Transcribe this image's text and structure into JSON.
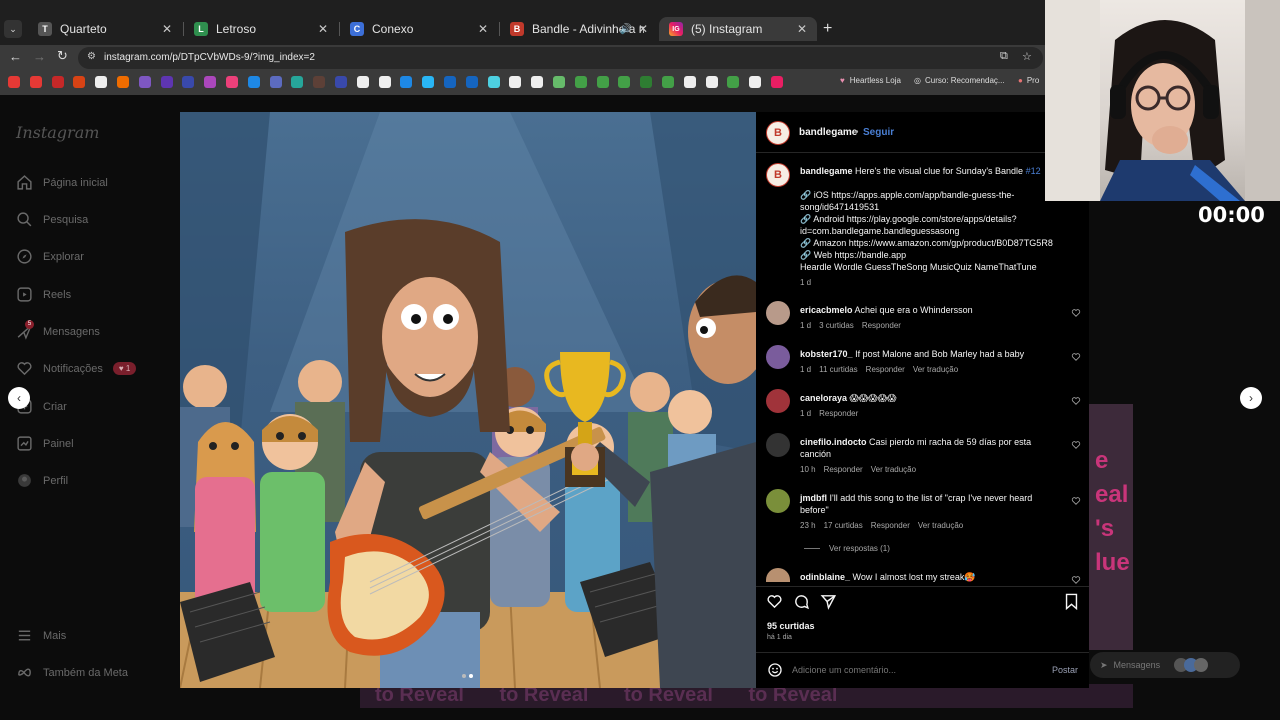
{
  "tabs": [
    {
      "label": "Quarteto",
      "favicon": "T"
    },
    {
      "label": "Letroso",
      "favicon": "L"
    },
    {
      "label": "Conexo",
      "favicon": "C"
    },
    {
      "label": "Bandle - Adivinhe a música",
      "favicon": "B"
    },
    {
      "label": "(5) Instagram",
      "favicon": "IG"
    }
  ],
  "new_tab": "+",
  "url": "instagram.com/p/DTpCVbWDs-9/?img_index=2",
  "bookmarks": [
    {
      "label": "Heartless Loja"
    },
    {
      "label": "Curso: Recomendaç..."
    },
    {
      "label": "Pro"
    }
  ],
  "sidebar": {
    "logo": "Instagram",
    "items": [
      {
        "label": "Página inicial",
        "icon": "home-icon"
      },
      {
        "label": "Pesquisa",
        "icon": "search-icon"
      },
      {
        "label": "Explorar",
        "icon": "compass-icon"
      },
      {
        "label": "Reels",
        "icon": "reels-icon"
      },
      {
        "label": "Mensagens",
        "icon": "messenger-icon",
        "badge": "5"
      },
      {
        "label": "Notificações",
        "icon": "heart-icon",
        "badge": "1"
      },
      {
        "label": "Criar",
        "icon": "plus-icon"
      },
      {
        "label": "Painel",
        "icon": "dashboard-icon"
      },
      {
        "label": "Perfil",
        "icon": "avatar-icon"
      }
    ],
    "more": "Mais",
    "meta": "Também da Meta"
  },
  "post": {
    "username": "bandlegame",
    "follow": "Seguir",
    "caption_user": "bandlegame",
    "caption_first": "Here's the visual clue for Sunday's Bandle",
    "caption_tag": "#12",
    "caption_lines": [
      "🔗 iOS https://apps.apple.com/app/bandle-guess-the-",
      "song/id6471419531",
      "🔗 Android https://play.google.com/store/apps/details?",
      "id=com.bandlegame.bandleguessasong",
      "🔗 Amazon https://www.amazon.com/gp/product/B0D87TG5R8",
      "🔗 Web https://bandle.app",
      "Heardle Wordle GuessTheSong MusicQuiz NameThatTune"
    ],
    "caption_time": "1 d",
    "likes": "95 curtidas",
    "posted": "há 1 dia",
    "comment_placeholder": "Adicione um comentário...",
    "post_button": "Postar"
  },
  "comments": [
    {
      "user": "ericacbmelo",
      "text": "Achei que era o Whindersson",
      "time": "1 d",
      "likes": "3 curtidas",
      "reply": "Responder",
      "translate": ""
    },
    {
      "user": "kobster170_",
      "text": "If post Malone and Bob Marley had a baby",
      "time": "1 d",
      "likes": "11 curtidas",
      "reply": "Responder",
      "translate": "Ver tradução"
    },
    {
      "user": "caneloraya",
      "text": "😱😱😱😱😱",
      "time": "1 d",
      "likes": "",
      "reply": "Responder",
      "translate": ""
    },
    {
      "user": "cinefilo.indocto",
      "text": "Casi pierdo mi racha de 59 días por esta",
      "text2": "canción",
      "time": "10 h",
      "likes": "",
      "reply": "Responder",
      "translate": "Ver tradução"
    },
    {
      "user": "jmdbfl",
      "text": "I'll add this song to the list of \"crap I've never heard",
      "text2": "before\"",
      "time": "23 h",
      "likes": "17 curtidas",
      "reply": "Responder",
      "translate": "Ver tradução"
    },
    {
      "user": "odinblaine_",
      "text": "Wow I almost lost my streak🥵",
      "time": "",
      "likes": "",
      "reply": "",
      "translate": ""
    }
  ],
  "view_replies": "Ver respostas (1)",
  "timer": "00:00",
  "messages_float": "Mensagens",
  "messages_badge": "5",
  "bg_text": "to Reveal",
  "bg_side_text": [
    "e",
    "eal",
    "'s",
    "lue"
  ]
}
